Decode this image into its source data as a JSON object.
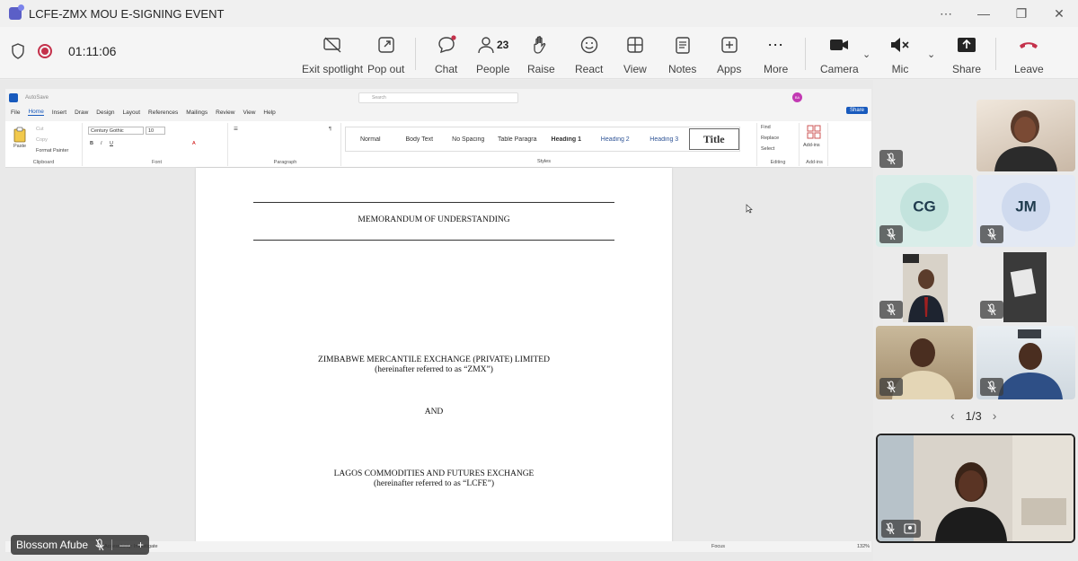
{
  "window": {
    "title": "LCFE-ZMX MOU E-SIGNING EVENT",
    "controls": [
      "⋯",
      "—",
      "❐",
      "✕"
    ]
  },
  "meeting": {
    "timer": "01:11:06",
    "buttons": {
      "exit_spotlight": "Exit spotlight",
      "pop_out": "Pop out",
      "chat": "Chat",
      "people": "People",
      "people_count": "23",
      "raise": "Raise",
      "react": "React",
      "view": "View",
      "notes": "Notes",
      "apps": "Apps",
      "more": "More",
      "camera": "Camera",
      "mic": "Mic",
      "share": "Share",
      "leave": "Leave"
    },
    "colors": {
      "leave": "#c4314b",
      "record": "#c4314b",
      "accent": "#5b5fc7"
    }
  },
  "word": {
    "autosave": "AutoSave",
    "search": "Search",
    "user_initials": "BA",
    "tabs": [
      "File",
      "Home",
      "Insert",
      "Draw",
      "Design",
      "Layout",
      "References",
      "Mailings",
      "Review",
      "View",
      "Help"
    ],
    "share": "Share",
    "ribbon": {
      "paste": "Paste",
      "cut": "Cut",
      "copy": "Copy",
      "format_painter": "Format Painter",
      "font_name": "Century Gothic",
      "font_size": "10",
      "styles": [
        "Normal",
        "Body Text",
        "No Spacing",
        "Table Paragra",
        "Heading 1",
        "Heading 2",
        "Heading 3",
        "Title"
      ],
      "find": "Find",
      "replace": "Replace",
      "select": "Select",
      "addins": "Add-ins",
      "groups": [
        "Clipboard",
        "Font",
        "Paragraph",
        "Styles",
        "Editing",
        "Add-ins"
      ]
    },
    "document": {
      "heading": "MEMORANDUM OF UNDERSTANDING",
      "party1": "ZIMBABWE MERCANTILE EXCHANGE (PRIVATE) LIMITED",
      "party1_ref": "(hereinafter referred to as “ZMX”)",
      "and": "AND",
      "party2": "LAGOS COMMODITIES AND FUTURES EXCHANGE",
      "party2_ref": "(hereinafter referred to as “LCFE”)"
    },
    "status": {
      "accessibility": "Accessibility: Investigate",
      "focus": "Focus",
      "zoom": "132%"
    }
  },
  "presenter": {
    "name": "Blossom Afube"
  },
  "gallery": {
    "participants": [
      {
        "initials": "CG",
        "bg": "#d6ece8"
      },
      {
        "initials": "JM",
        "bg": "#dfe6f3"
      }
    ],
    "page": "1/3"
  }
}
